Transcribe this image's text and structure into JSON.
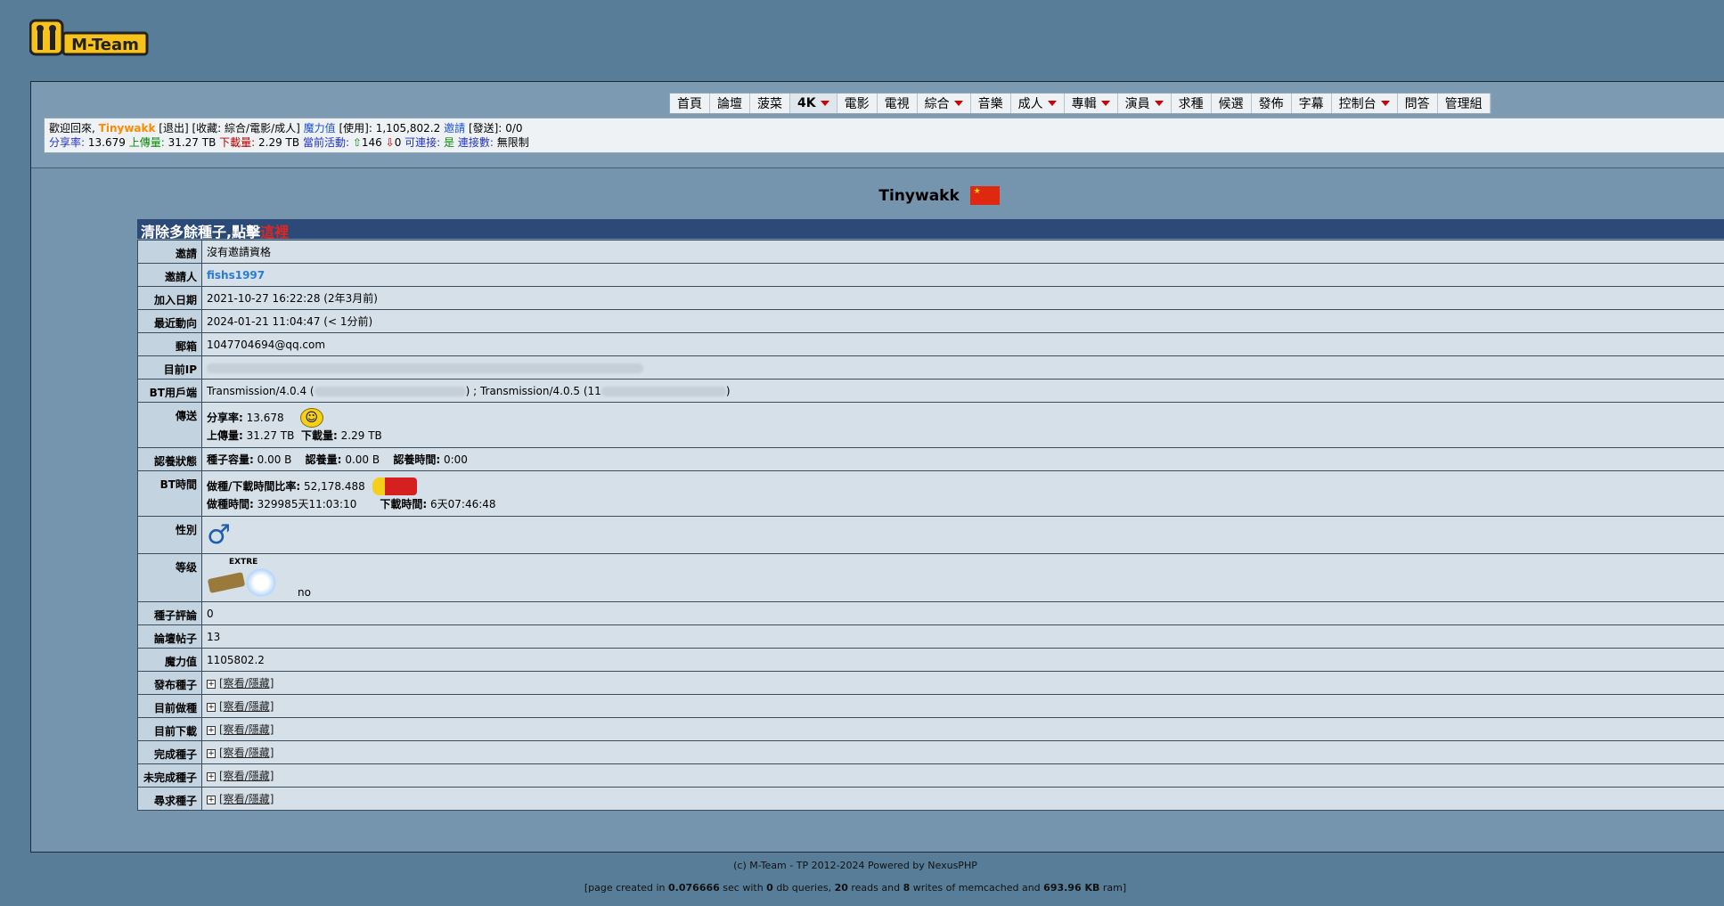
{
  "logo": {
    "text": "M-Team"
  },
  "nav": [
    {
      "label": "首頁",
      "caret": false
    },
    {
      "label": "論壇",
      "caret": false
    },
    {
      "label": "菠菜",
      "caret": false
    },
    {
      "label": "4K",
      "caret": true
    },
    {
      "label": "電影",
      "caret": false
    },
    {
      "label": "電視",
      "caret": false
    },
    {
      "label": "綜合",
      "caret": true
    },
    {
      "label": "音樂",
      "caret": false
    },
    {
      "label": "成人",
      "caret": true
    },
    {
      "label": "專輯",
      "caret": true
    },
    {
      "label": "演員",
      "caret": true
    },
    {
      "label": "求種",
      "caret": false
    },
    {
      "label": "候選",
      "caret": false
    },
    {
      "label": "發佈",
      "caret": false
    },
    {
      "label": "字幕",
      "caret": false
    },
    {
      "label": "控制台",
      "caret": true
    },
    {
      "label": "問答",
      "caret": false
    },
    {
      "label": "管理組",
      "caret": false
    }
  ],
  "infobar": {
    "welcome": "歡迎回來,",
    "username": "Tinywakk",
    "logout": "[退出]",
    "favorites": "[收藏: 綜合/電影/成人]",
    "bonus_label": "魔力值",
    "bonus_use": "[使用]:",
    "bonus_value": "1,105,802.2",
    "invite_label": "邀請",
    "invite_send": "[發送]:",
    "invite_value": "0/0",
    "ratio_label": "分享率:",
    "ratio_value": "13.679",
    "uploaded_label": "上傳量:",
    "uploaded_value": "31.27 TB",
    "downloaded_label": "下載量:",
    "downloaded_value": "2.29 TB",
    "active_label": "當前活動:",
    "seeding": "146",
    "leeching": "0",
    "connectable_label": "可連接:",
    "connectable_value": "是",
    "connections_label": "連接數:",
    "connections_value": "無限制"
  },
  "profile": {
    "username": "Tinywakk",
    "flag": "CN",
    "warning_prefix": "清除多餘種子,點擊",
    "warning_link": "這裡"
  },
  "rows": {
    "invite": {
      "k": "邀請",
      "v": "沒有邀請資格"
    },
    "inviter": {
      "k": "邀請人",
      "v": "fishs1997"
    },
    "joined": {
      "k": "加入日期",
      "v": "2021-10-27 16:22:28 (2年3月前)"
    },
    "last_action": {
      "k": "最近動向",
      "v": "2024-01-21 11:04:47 (< 1分前)"
    },
    "email": {
      "k": "郵箱",
      "v": "1047704694@qq.com"
    },
    "ip": {
      "k": "目前IP"
    },
    "client": {
      "k": "BT用戶端",
      "a": "Transmission/4.0.4 (",
      "b": ") ; Transmission/4.0.5 (11",
      "c": ")"
    },
    "transfer": {
      "k": "傳送",
      "ratio_label": "分享率:",
      "ratio": "13.678",
      "up_label": "上傳量:",
      "up": "31.27 TB",
      "down_label": "下載量:",
      "down": "2.29 TB"
    },
    "adopt": {
      "k": "認養狀態",
      "size_label": "種子容量:",
      "size": "0.00 B",
      "amount_label": "認養量:",
      "amount": "0.00 B",
      "time_label": "認養時間:",
      "time": "0:00"
    },
    "bt_time": {
      "k": "BT時間",
      "ratio_label": "做種/下載時間比率:",
      "ratio": "52,178.488",
      "seed_label": "做種時間:",
      "seed": "329985天11:03:10",
      "dl_label": "下載時間:",
      "dl": "6天07:46:48"
    },
    "gender": {
      "k": "性別",
      "symbol": "♂"
    },
    "class": {
      "k": "等级",
      "badge": "EXTRE",
      "text": "no"
    },
    "comments": {
      "k": "種子評論",
      "v": "0"
    },
    "posts": {
      "k": "論壇帖子",
      "v": "13"
    },
    "bonus": {
      "k": "魔力值",
      "v": "1105802.2"
    },
    "uploaded_t": {
      "k": "發布種子",
      "v": "[察看/隱藏]"
    },
    "seeding_t": {
      "k": "目前做種",
      "v": "[察看/隱藏]"
    },
    "leeching_t": {
      "k": "目前下載",
      "v": "[察看/隱藏]"
    },
    "completed_t": {
      "k": "完成種子",
      "v": "[察看/隱藏]"
    },
    "incomplete_t": {
      "k": "未完成種子",
      "v": "[察看/隱藏]"
    },
    "requests_t": {
      "k": "尋求種子",
      "v": "[察看/隱藏]"
    }
  },
  "footer": {
    "line1": "(c) M-Team - TP 2012-2024 Powered by NexusPHP",
    "l2_a": "[page created in ",
    "l2_sec": "0.076666",
    "l2_b": " sec with ",
    "l2_q": "0",
    "l2_c": " db queries, ",
    "l2_r": "20",
    "l2_d": " reads and ",
    "l2_w": "8",
    "l2_e": " writes of memcached and ",
    "l2_ram": "693.96 KB",
    "l2_f": " ram]"
  }
}
